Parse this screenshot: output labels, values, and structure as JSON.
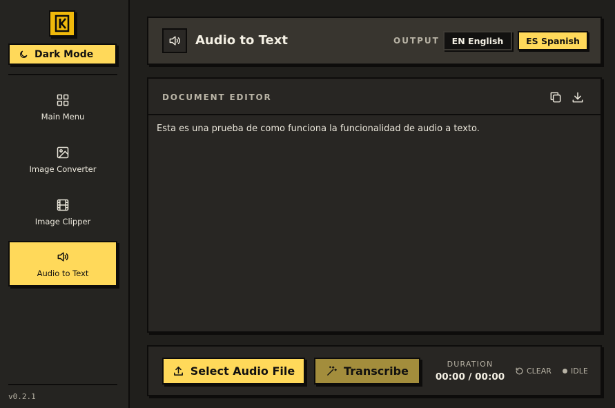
{
  "sidebar": {
    "dark_mode_label": "Dark Mode",
    "items": [
      {
        "label": "Main Menu",
        "icon": "grid-icon"
      },
      {
        "label": "Image Converter",
        "icon": "image-icon"
      },
      {
        "label": "Image Clipper",
        "icon": "film-icon"
      },
      {
        "label": "Audio to Text",
        "icon": "speaker-icon",
        "active": true
      }
    ],
    "version": "v0.2.1"
  },
  "header": {
    "title": "Audio to Text",
    "output_label": "OUTPUT",
    "languages": [
      {
        "label": "EN English",
        "selected": false
      },
      {
        "label": "ES Spanish",
        "selected": true
      }
    ]
  },
  "editor": {
    "title": "DOCUMENT EDITOR",
    "text": "Esta es una prueba de como funciona la funcionalidad de audio a texto."
  },
  "controls": {
    "select_label": "Select Audio File",
    "transcribe_label": "Transcribe",
    "duration_label": "DURATION",
    "duration_value": "00:00 / 00:00",
    "clear_label": "CLEAR",
    "status_label": "IDLE"
  },
  "colors": {
    "accent": "#ffd95a",
    "accent_muted": "#a38d3c",
    "logo": "#f0b90b",
    "background": "#201f1c",
    "panel": "#282623",
    "header_panel": "#38352f"
  }
}
